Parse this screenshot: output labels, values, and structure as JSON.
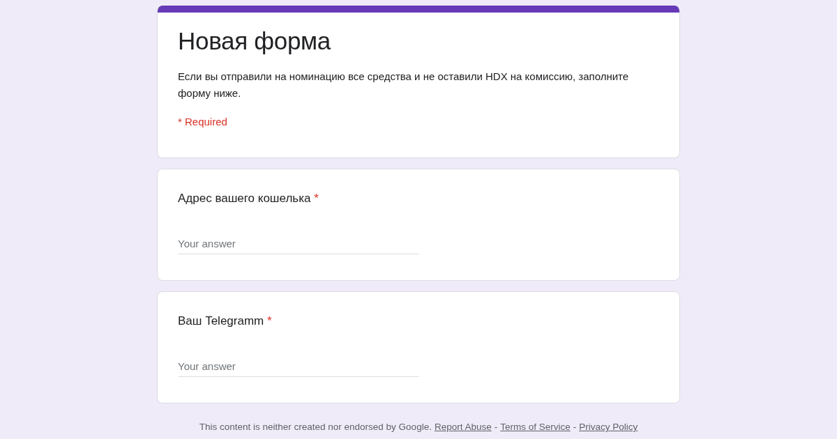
{
  "header": {
    "title": "Новая форма",
    "description": "Если вы отправили на номинацию все средства и не оставили HDX на комиссию, заполните форму ниже.",
    "required_note": "* Required"
  },
  "questions": [
    {
      "label": "Адрес вашего кошелька",
      "required_mark": "*",
      "placeholder": "Your answer"
    },
    {
      "label": "Ваш Telegramm",
      "required_mark": "*",
      "placeholder": "Your answer"
    }
  ],
  "footer": [
    {
      "kind": "text",
      "text": "This content is neither created nor endorsed by Google."
    },
    {
      "kind": "link",
      "text": "Report Abuse"
    },
    {
      "kind": "sep",
      "text": "-"
    },
    {
      "kind": "link",
      "text": "Terms of Service"
    },
    {
      "kind": "sep",
      "text": "-"
    },
    {
      "kind": "link",
      "text": "Privacy Policy"
    }
  ]
}
